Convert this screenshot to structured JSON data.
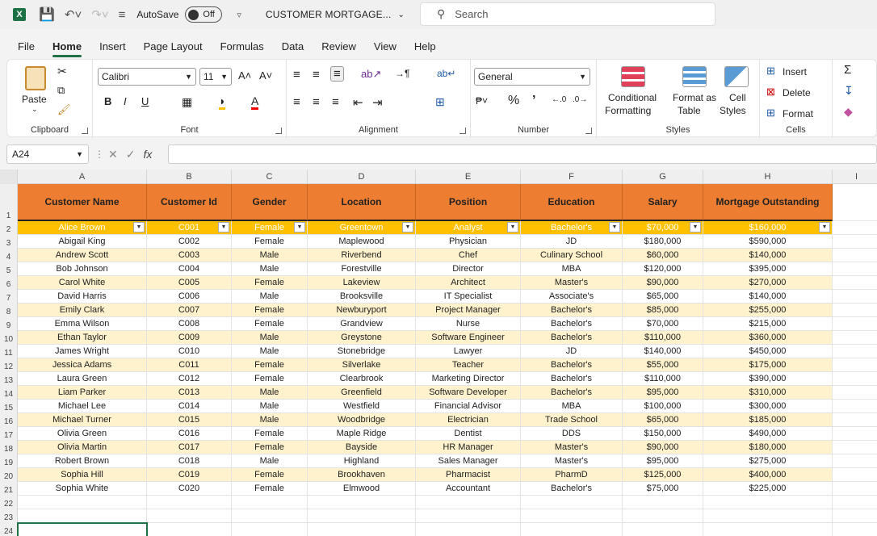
{
  "titlebar": {
    "autosave_label": "AutoSave",
    "autosave_state": "Off",
    "document_title": "CUSTOMER MORTGAGE...",
    "search_placeholder": "Search"
  },
  "menu": [
    "File",
    "Home",
    "Insert",
    "Page Layout",
    "Formulas",
    "Data",
    "Review",
    "View",
    "Help"
  ],
  "active_menu": "Home",
  "ribbon": {
    "clipboard": {
      "paste": "Paste",
      "label": "Clipboard"
    },
    "font": {
      "name": "Calibri",
      "size": "11",
      "label": "Font"
    },
    "alignment": {
      "label": "Alignment"
    },
    "number": {
      "format": "General",
      "label": "Number"
    },
    "styles": {
      "conditional_1": "Conditional",
      "conditional_2": "Formatting",
      "format_table_1": "Format as",
      "format_table_2": "Table",
      "cell_styles_1": "Cell",
      "cell_styles_2": "Styles",
      "label": "Styles"
    },
    "cells": {
      "insert": "Insert",
      "delete": "Delete",
      "format": "Format",
      "label": "Cells"
    }
  },
  "formula_bar": {
    "name_box": "A24",
    "formula": ""
  },
  "columns": [
    "A",
    "B",
    "C",
    "D",
    "E",
    "F",
    "G",
    "H",
    "I"
  ],
  "table": {
    "headers": [
      "Customer Name",
      "Customer Id",
      "Gender",
      "Location",
      "Position",
      "Education",
      "Salary",
      "Mortgage Outstanding"
    ],
    "rows": [
      [
        "Alice Brown",
        "C001",
        "Female",
        "Greentown",
        "Analyst",
        "Bachelor's",
        "$70,000",
        "$160,000"
      ],
      [
        "Abigail King",
        "C002",
        "Female",
        "Maplewood",
        "Physician",
        "JD",
        "$180,000",
        "$590,000"
      ],
      [
        "Andrew Scott",
        "C003",
        "Male",
        "Riverbend",
        "Chef",
        "Culinary School",
        "$60,000",
        "$140,000"
      ],
      [
        "Bob Johnson",
        "C004",
        "Male",
        "Forestville",
        "Director",
        "MBA",
        "$120,000",
        "$395,000"
      ],
      [
        "Carol White",
        "C005",
        "Female",
        "Lakeview",
        "Architect",
        "Master's",
        "$90,000",
        "$270,000"
      ],
      [
        "David Harris",
        "C006",
        "Male",
        "Brooksville",
        "IT Specialist",
        "Associate's",
        "$65,000",
        "$140,000"
      ],
      [
        "Emily Clark",
        "C007",
        "Female",
        "Newburyport",
        "Project Manager",
        "Bachelor's",
        "$85,000",
        "$255,000"
      ],
      [
        "Emma Wilson",
        "C008",
        "Female",
        "Grandview",
        "Nurse",
        "Bachelor's",
        "$70,000",
        "$215,000"
      ],
      [
        "Ethan Taylor",
        "C009",
        "Male",
        "Greystone",
        "Software Engineer",
        "Bachelor's",
        "$110,000",
        "$360,000"
      ],
      [
        "James Wright",
        "C010",
        "Male",
        "Stonebridge",
        "Lawyer",
        "JD",
        "$140,000",
        "$450,000"
      ],
      [
        "Jessica Adams",
        "C011",
        "Female",
        "Silverlake",
        "Teacher",
        "Bachelor's",
        "$55,000",
        "$175,000"
      ],
      [
        "Laura Green",
        "C012",
        "Female",
        "Clearbrook",
        "Marketing Director",
        "Bachelor's",
        "$110,000",
        "$390,000"
      ],
      [
        "Liam Parker",
        "C013",
        "Male",
        "Greenfield",
        "Software Developer",
        "Bachelor's",
        "$95,000",
        "$310,000"
      ],
      [
        "Michael Lee",
        "C014",
        "Male",
        "Westfield",
        "Financial Advisor",
        "MBA",
        "$100,000",
        "$300,000"
      ],
      [
        "Michael Turner",
        "C015",
        "Male",
        "Woodbridge",
        "Electrician",
        "Trade School",
        "$65,000",
        "$185,000"
      ],
      [
        "Olivia Green",
        "C016",
        "Female",
        "Maple Ridge",
        "Dentist",
        "DDS",
        "$150,000",
        "$490,000"
      ],
      [
        "Olivia Martin",
        "C017",
        "Female",
        "Bayside",
        "HR Manager",
        "Master's",
        "$90,000",
        "$180,000"
      ],
      [
        "Robert Brown",
        "C018",
        "Male",
        "Highland",
        "Sales Manager",
        "Master's",
        "$95,000",
        "$275,000"
      ],
      [
        "Sophia Hill",
        "C019",
        "Female",
        "Brookhaven",
        "Pharmacist",
        "PharmD",
        "$125,000",
        "$400,000"
      ],
      [
        "Sophia White",
        "C020",
        "Female",
        "Elmwood",
        "Accountant",
        "Bachelor's",
        "$75,000",
        "$225,000"
      ]
    ]
  },
  "row_numbers": [
    "1",
    "2",
    "3",
    "4",
    "5",
    "6",
    "7",
    "8",
    "9",
    "10",
    "11",
    "12",
    "13",
    "14",
    "15",
    "16",
    "17",
    "18",
    "19",
    "20",
    "21",
    "22",
    "23",
    "24"
  ],
  "colors": {
    "header_orange": "#ed7d31",
    "filter_row_gold": "#ffc000",
    "band_light": "#fff2cc",
    "excel_green": "#1e7145"
  }
}
